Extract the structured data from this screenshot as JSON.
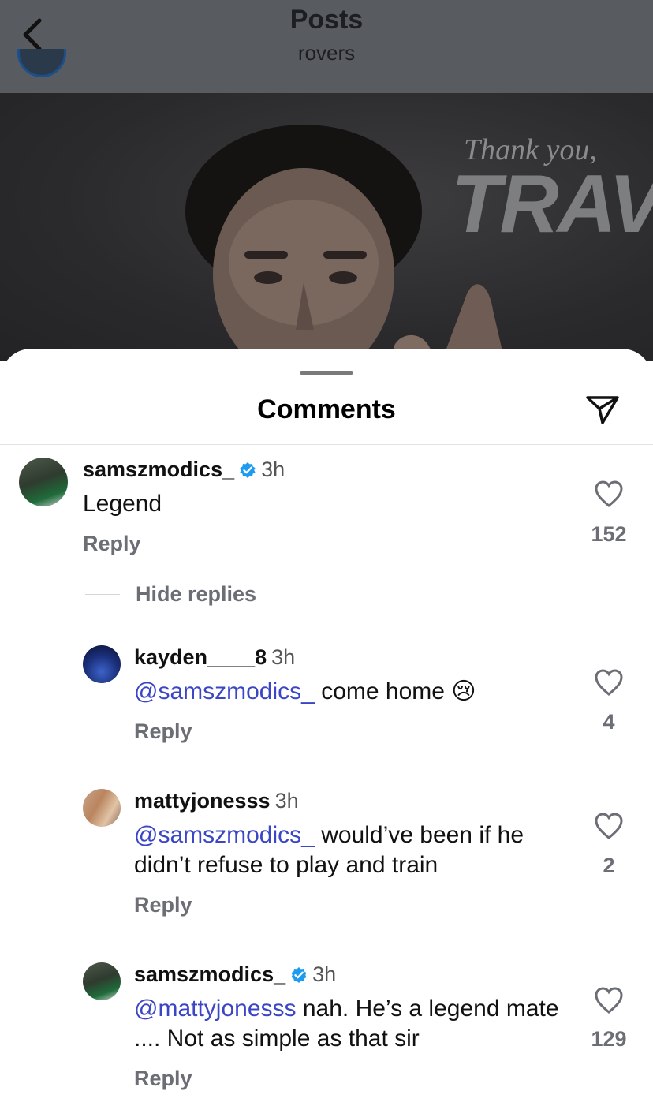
{
  "header": {
    "title": "Posts",
    "subtitle": "rovers"
  },
  "post": {
    "overlay_line1": "Thank you,",
    "overlay_line2": "TRAV"
  },
  "sheet": {
    "title": "Comments"
  },
  "hide_replies_label": "Hide replies",
  "comments": [
    {
      "username": "samszmodics_",
      "verified": true,
      "time": "3h",
      "mention": "",
      "text": "Legend",
      "reply_label": "Reply",
      "likes": "152"
    },
    {
      "username": "kayden____8",
      "verified": false,
      "time": "3h",
      "mention": "@samszmodics_",
      "text": "come home 😢",
      "reply_label": "Reply",
      "likes": "4"
    },
    {
      "username": "mattyjonesss",
      "verified": false,
      "time": "3h",
      "mention": "@samszmodics_",
      "text": "would’ve been if he didn’t refuse to play and train",
      "reply_label": "Reply",
      "likes": "2"
    },
    {
      "username": "samszmodics_",
      "verified": true,
      "time": "3h",
      "mention": "@mattyjonesss",
      "text": "nah. He’s a legend mate .... Not as simple as that sir",
      "reply_label": "Reply",
      "likes": "129"
    }
  ],
  "colors": {
    "mention": "#3b46c4",
    "verified": "#1d9bf0",
    "secondary_text": "#6b6e74"
  }
}
